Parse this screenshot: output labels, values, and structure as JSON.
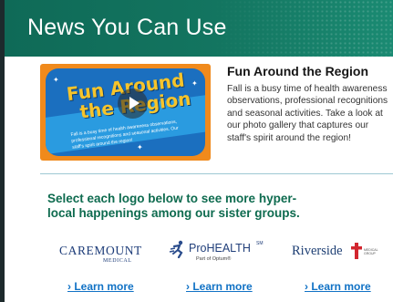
{
  "banner": {
    "title": "News You Can Use"
  },
  "feature": {
    "thumbnail": {
      "title_line1": "Fun Around",
      "title_line2": "the Region",
      "small_text": "Fall is a busy time of health awareness observations, professional recognitions and seasonal activities. Our staff's spirit around the region!"
    },
    "title": "Fun Around the Region",
    "body": "Fall is a busy time of health awareness observations, professional recognitions and seasonal activities. Take a look at our photo gallery that captures our staff's spirit around the region!"
  },
  "cta": {
    "text": "Select each logo below to see more hyper-local happenings among our sister groups."
  },
  "logos": {
    "caremount": {
      "main": "CAREMOUNT",
      "sub": "MEDICAL"
    },
    "prohealth": {
      "main": "ProHEALTH",
      "tm": "SM",
      "sub": "Part of Optum®"
    },
    "riverside": {
      "main": "Riverside",
      "sub": "MEDICAL GROUP"
    }
  },
  "links": {
    "learn_more_1": "› Learn more",
    "learn_more_2": "› Learn more",
    "learn_more_3": "› Learn more"
  },
  "colors": {
    "banner": "#137560",
    "cta_text": "#0e6b4f",
    "link": "#1172c5",
    "thumbnail_border": "#f08a1c",
    "thumbnail_fill": "#1b6fbf"
  }
}
